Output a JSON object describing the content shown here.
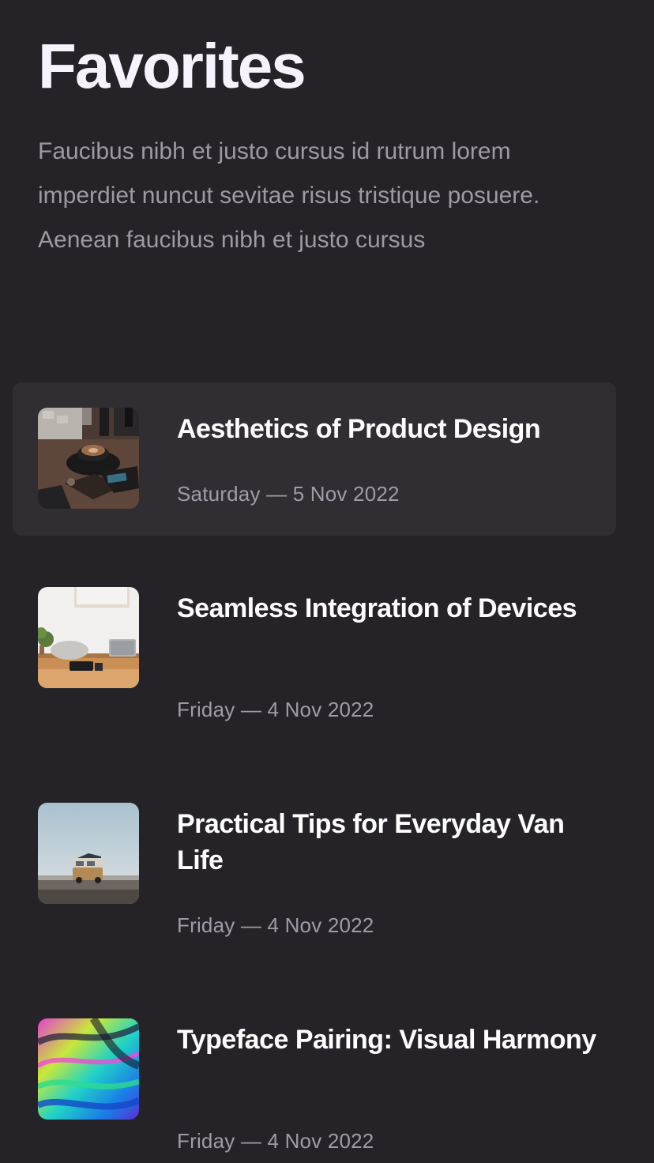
{
  "page": {
    "title": "Favorites",
    "intro": "Faucibus nibh et justo cursus id rutrum lorem imperdiet nuncut sevitae risus tristique posuere. Aenean faucibus nibh et justo cursus"
  },
  "favorites": [
    {
      "title": "Aesthetics of Product Design",
      "date": "Saturday — 5 Nov 2022",
      "image": "coffee-cup-desk-photo",
      "selected": true
    },
    {
      "title": "Seamless Integration of Devices",
      "date": "Friday — 4 Nov 2022",
      "image": "workspace-laptop-photo",
      "selected": false
    },
    {
      "title": "Practical Tips for Everyday Van Life",
      "date": "Friday — 4 Nov 2022",
      "image": "camper-van-photo",
      "selected": false
    },
    {
      "title": "Typeface Pairing: Visual Harmony",
      "date": "Friday — 4 Nov 2022",
      "image": "colorful-abstract-photo",
      "selected": false
    }
  ],
  "colors": {
    "background": "#252328",
    "selected_row": "#302e33",
    "title": "#ffffff",
    "muted_text": "#a09ca7"
  }
}
